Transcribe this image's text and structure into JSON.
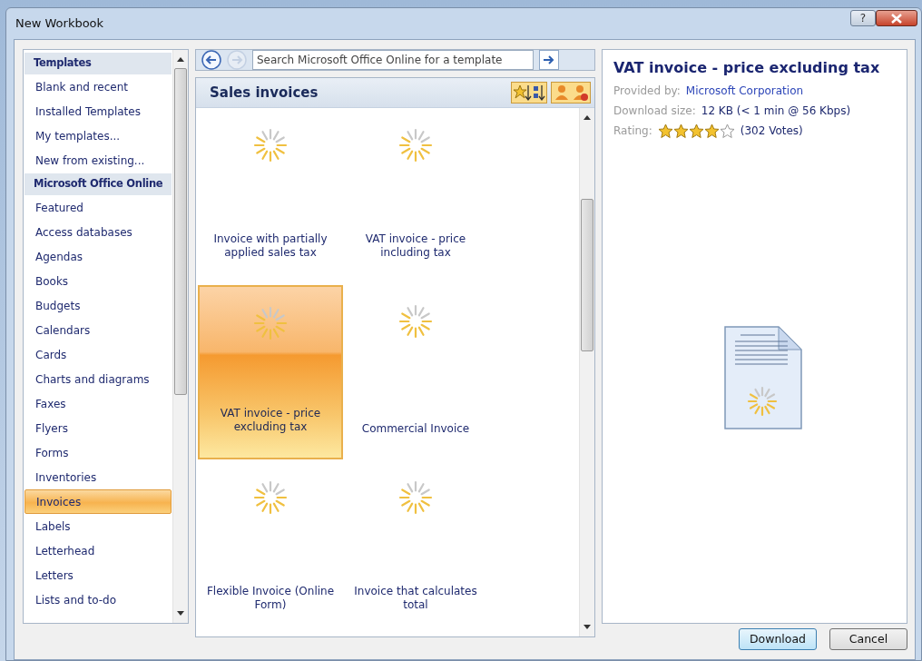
{
  "window": {
    "title": "New Workbook",
    "help": "?"
  },
  "sidebar": {
    "items": [
      {
        "kind": "header",
        "label": "Templates",
        "selected": false
      },
      {
        "kind": "item",
        "label": "Blank and recent",
        "selected": false
      },
      {
        "kind": "item",
        "label": "Installed Templates",
        "selected": false
      },
      {
        "kind": "item",
        "label": "My templates...",
        "selected": false
      },
      {
        "kind": "item",
        "label": "New from existing...",
        "selected": false
      },
      {
        "kind": "header",
        "label": "Microsoft Office Online",
        "selected": false
      },
      {
        "kind": "item",
        "label": "Featured",
        "selected": false
      },
      {
        "kind": "item",
        "label": "Access databases",
        "selected": false
      },
      {
        "kind": "item",
        "label": "Agendas",
        "selected": false
      },
      {
        "kind": "item",
        "label": "Books",
        "selected": false
      },
      {
        "kind": "item",
        "label": "Budgets",
        "selected": false
      },
      {
        "kind": "item",
        "label": "Calendars",
        "selected": false
      },
      {
        "kind": "item",
        "label": "Cards",
        "selected": false
      },
      {
        "kind": "item",
        "label": "Charts and diagrams",
        "selected": false
      },
      {
        "kind": "item",
        "label": "Faxes",
        "selected": false
      },
      {
        "kind": "item",
        "label": "Flyers",
        "selected": false
      },
      {
        "kind": "item",
        "label": "Forms",
        "selected": false
      },
      {
        "kind": "item",
        "label": "Inventories",
        "selected": false
      },
      {
        "kind": "item",
        "label": "Invoices",
        "selected": true
      },
      {
        "kind": "item",
        "label": "Labels",
        "selected": false
      },
      {
        "kind": "item",
        "label": "Letterhead",
        "selected": false
      },
      {
        "kind": "item",
        "label": "Letters",
        "selected": false
      },
      {
        "kind": "item",
        "label": "Lists and to-do",
        "selected": false
      }
    ]
  },
  "navigation": {
    "back_disabled": false,
    "forward_disabled": true,
    "search": {
      "placeholder": "Search Microsoft Office Online for a template"
    }
  },
  "gallery": {
    "title": "Sales invoices",
    "tiles": [
      {
        "label": "Invoice with partially applied sales tax",
        "selected": false
      },
      {
        "label": "VAT invoice - price including tax",
        "selected": false
      },
      {
        "label": "VAT invoice - price excluding tax",
        "selected": true
      },
      {
        "label": "Commercial Invoice",
        "selected": false
      },
      {
        "label": "Flexible Invoice (Online Form)",
        "selected": false
      },
      {
        "label": "Invoice that calculates total",
        "selected": false
      }
    ]
  },
  "details": {
    "title": "VAT invoice - price excluding tax",
    "provider_label": "Provided by:",
    "provider": "Microsoft Corporation",
    "size_label": "Download size:",
    "size": "12 KB (< 1 min @ 56 Kbps)",
    "rating_label": "Rating:",
    "stars": 4,
    "votes": "(302 Votes)"
  },
  "buttons": [
    {
      "label": "Download",
      "kind": "default"
    },
    {
      "label": "Cancel",
      "kind": "normal"
    }
  ]
}
